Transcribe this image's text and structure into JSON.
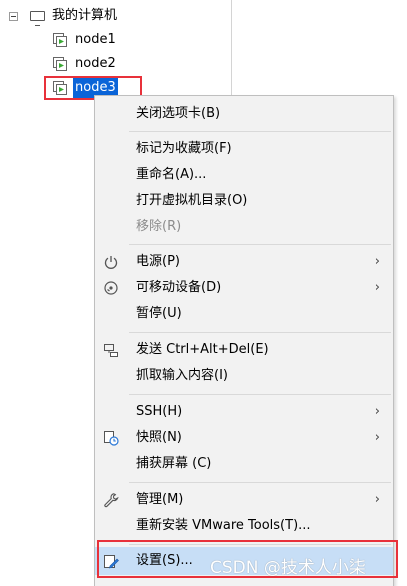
{
  "tree": {
    "root_label": "我的计算机",
    "vms": [
      {
        "label": "node1"
      },
      {
        "label": "node2"
      },
      {
        "label": "node3"
      }
    ]
  },
  "menu": {
    "items": [
      {
        "label": "关闭选项卡(B)"
      },
      {
        "label": "标记为收藏项(F)"
      },
      {
        "label": "重命名(A)..."
      },
      {
        "label": "打开虚拟机目录(O)"
      },
      {
        "label": "移除(R)",
        "disabled": true
      },
      {
        "label": "电源(P)",
        "icon": "power-icon",
        "submenu": true
      },
      {
        "label": "可移动设备(D)",
        "icon": "removable-devices-icon",
        "submenu": true
      },
      {
        "label": "暂停(U)"
      },
      {
        "label": "发送 Ctrl+Alt+Del(E)",
        "icon": "send-keys-icon"
      },
      {
        "label": "抓取输入内容(I)"
      },
      {
        "label": "SSH(H)",
        "submenu": true
      },
      {
        "label": "快照(N)",
        "icon": "snapshot-icon",
        "submenu": true
      },
      {
        "label": "捕获屏幕 (C)"
      },
      {
        "label": "管理(M)",
        "icon": "wrench-icon",
        "submenu": true
      },
      {
        "label": "重新安装 VMware Tools(T)..."
      },
      {
        "label": "设置(S)...",
        "icon": "settings-icon",
        "highlighted": true
      }
    ],
    "arrow_glyph": "›"
  },
  "watermark": "CSDN @技术人小柒",
  "colors": {
    "selection": "#0a64d8",
    "highlight_box": "#e8313a",
    "menu_background": "#f2f2f2",
    "vm_icon_green": "#3aa834"
  }
}
